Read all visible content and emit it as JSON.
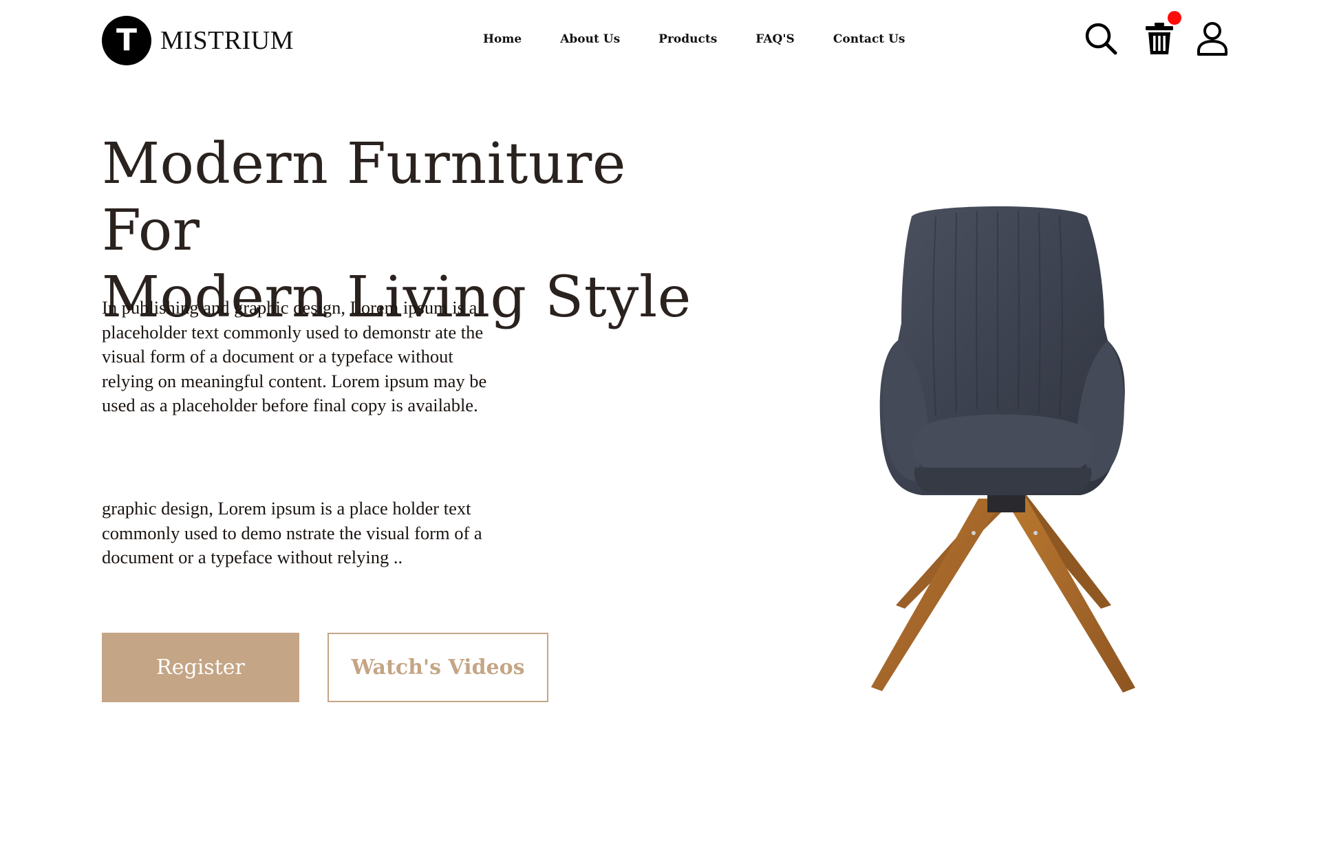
{
  "brand": {
    "logo_letter": "T",
    "name": "MISTRIUM"
  },
  "nav": {
    "items": [
      {
        "label": "Home"
      },
      {
        "label": "About Us"
      },
      {
        "label": "Products"
      },
      {
        "label": "FAQ'S"
      },
      {
        "label": "Contact Us"
      }
    ]
  },
  "header_icons": {
    "search": "search-icon",
    "cart": "trash-bin-cart-icon",
    "user": "user-icon",
    "cart_badge_color": "#ff0a0a"
  },
  "hero": {
    "title_line1": "Modern Furniture For",
    "title_line2": "Modern Living Style",
    "paragraph1": "In publishing and graphic design, Lorem ipsum is a placeholder text commonly used to demonstr ate the visual form of a document or a typeface without relying on meaningful content. Lorem ipsum may be used as a placeholder before final copy is available.",
    "paragraph2": "graphic design, Lorem ipsum is a place holder text commonly used to demo nstrate the visual form of a document or a typeface without relying ..",
    "register_label": "Register",
    "videos_label": "Watch's Videos",
    "image": "armchair-photo"
  },
  "colors": {
    "accent": "#c4a585",
    "text": "#2a221e",
    "background": "#ffffff"
  }
}
